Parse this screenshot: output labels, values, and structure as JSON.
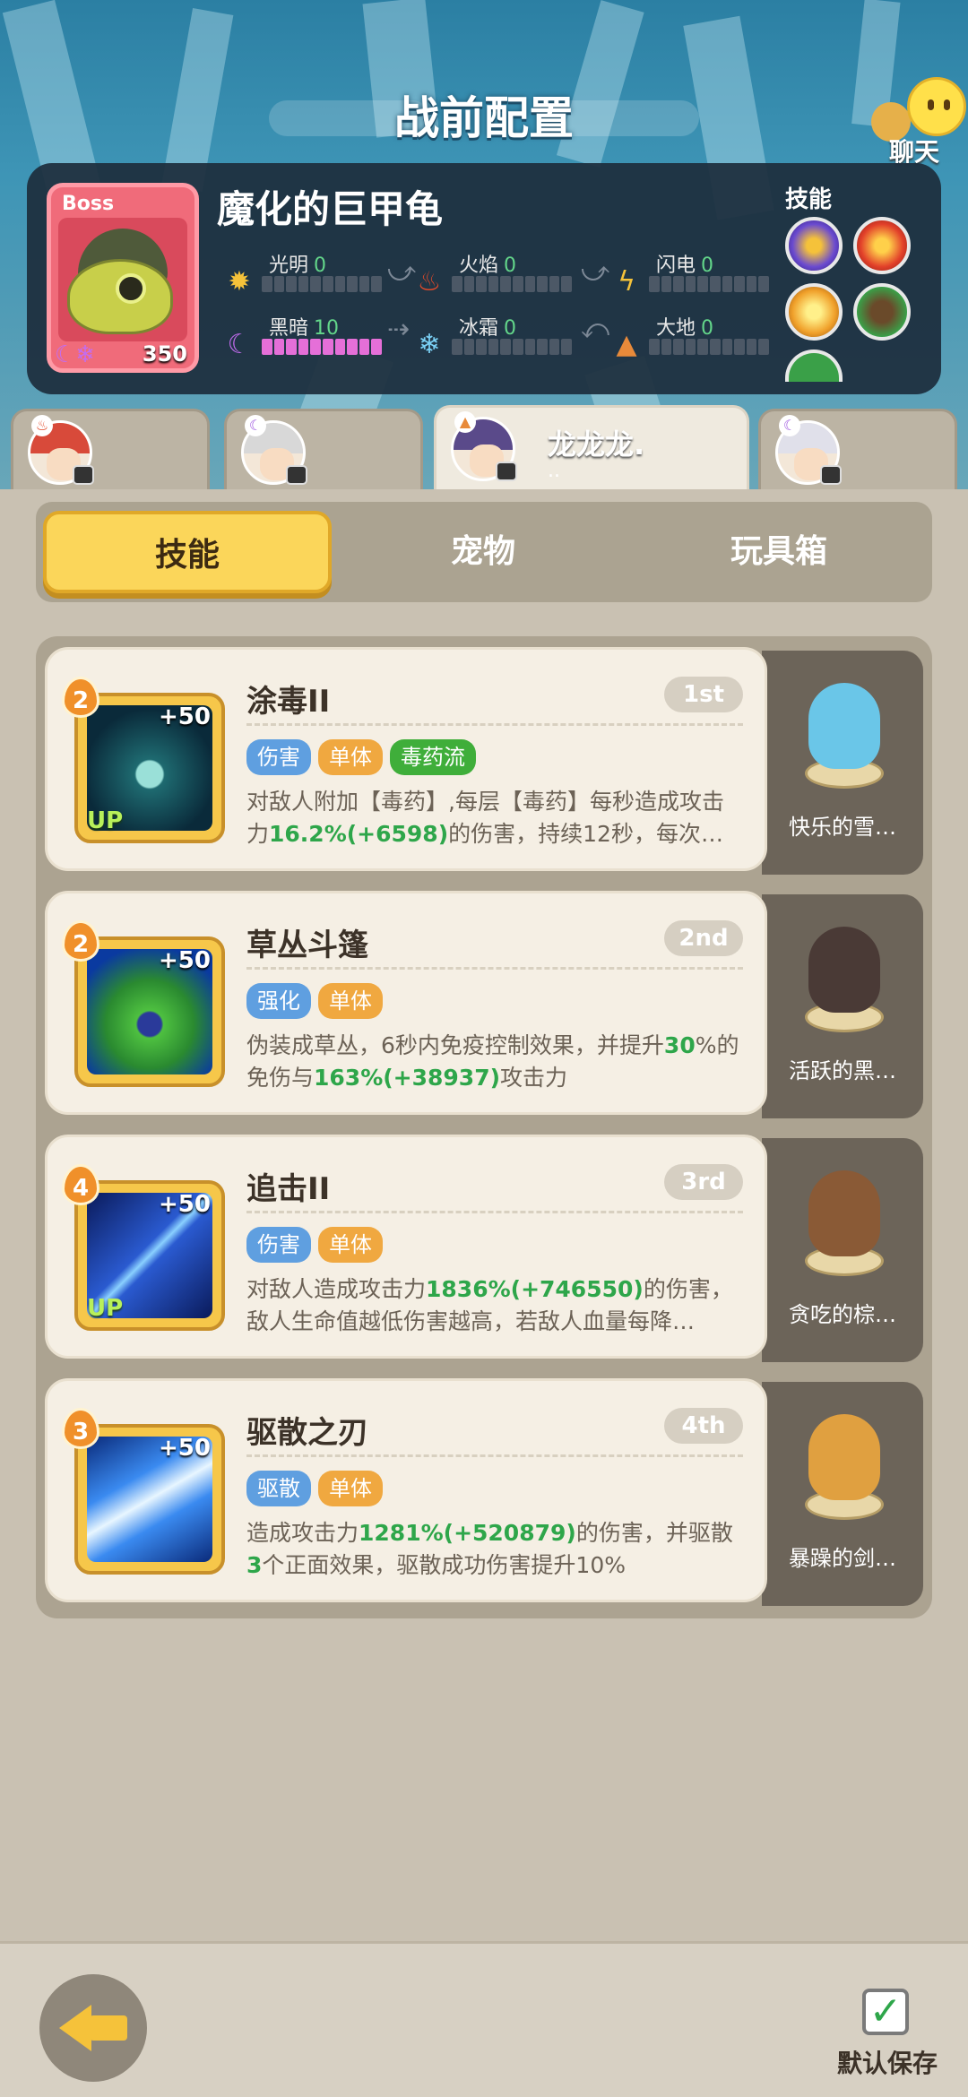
{
  "header": {
    "title": "战前配置",
    "chat_label": "聊天"
  },
  "boss": {
    "badge": "Boss",
    "name": "魔化的巨甲龟",
    "level": "350",
    "elements": [
      {
        "name": "光明",
        "value": "0",
        "icon": "sun-icon",
        "filled": 0
      },
      {
        "name": "火焰",
        "value": "0",
        "icon": "flame-icon",
        "filled": 0
      },
      {
        "name": "闪电",
        "value": "0",
        "icon": "lightning-icon",
        "filled": 0
      },
      {
        "name": "黑暗",
        "value": "10",
        "icon": "moon-icon",
        "filled": 10
      },
      {
        "name": "冰霜",
        "value": "0",
        "icon": "snowflake-icon",
        "filled": 0
      },
      {
        "name": "大地",
        "value": "0",
        "icon": "mountain-icon",
        "filled": 0
      }
    ],
    "skills_label": "技能"
  },
  "characters": [
    {
      "name": "",
      "active": false,
      "hair_color": "#d84a3a"
    },
    {
      "name": "",
      "active": false,
      "hair_color": "#d8d8d8"
    },
    {
      "name": "龙龙龙.",
      "sub": "..",
      "active": true,
      "hair_color": "#5a4a8a"
    },
    {
      "name": "",
      "active": false,
      "hair_color": "#e0e0ea"
    }
  ],
  "tabs": [
    "技能",
    "宠物",
    "玩具箱"
  ],
  "skills": [
    {
      "name": "涂毒II",
      "rank": "1st",
      "level": "2",
      "plus": "+50",
      "up": "UP",
      "tags": [
        {
          "text": "伤害",
          "color": "blue"
        },
        {
          "text": "单体",
          "color": "orange"
        },
        {
          "text": "毒药流",
          "color": "green"
        }
      ],
      "desc_parts": [
        "对敌人附加【毒药】,每层【毒药】每秒造成攻击力",
        "16.2%(+6598)",
        "的伤害，持续12秒，每次…"
      ],
      "pet_name": "快乐的雪…"
    },
    {
      "name": "草丛斗篷",
      "rank": "2nd",
      "level": "2",
      "plus": "+50",
      "up": "",
      "tags": [
        {
          "text": "强化",
          "color": "blue"
        },
        {
          "text": "单体",
          "color": "orange"
        }
      ],
      "desc_parts": [
        "伪装成草丛，6秒内免疫控制效果，并提升",
        "30",
        "%的免伤与",
        "163%(+38937)",
        "攻击力"
      ],
      "pet_name": "活跃的黑…"
    },
    {
      "name": "追击II",
      "rank": "3rd",
      "level": "4",
      "plus": "+50",
      "up": "UP",
      "tags": [
        {
          "text": "伤害",
          "color": "blue"
        },
        {
          "text": "单体",
          "color": "orange"
        }
      ],
      "desc_parts": [
        "对敌人造成攻击力",
        "1836%(+746550)",
        "的伤害，敌人生命值越低伤害越高，若敌人血量每降…"
      ],
      "pet_name": "贪吃的棕…"
    },
    {
      "name": "驱散之刃",
      "rank": "4th",
      "level": "3",
      "plus": "+50",
      "up": "",
      "tags": [
        {
          "text": "驱散",
          "color": "blue"
        },
        {
          "text": "单体",
          "color": "orange"
        }
      ],
      "desc_parts": [
        "造成攻击力",
        "1281%(+520879)",
        "的伤害，并驱散",
        "3",
        "个正面效果，驱散成功伤害提升10%"
      ],
      "pet_name": "暴躁的剑…"
    }
  ],
  "footer": {
    "save_label": "默认保存"
  }
}
